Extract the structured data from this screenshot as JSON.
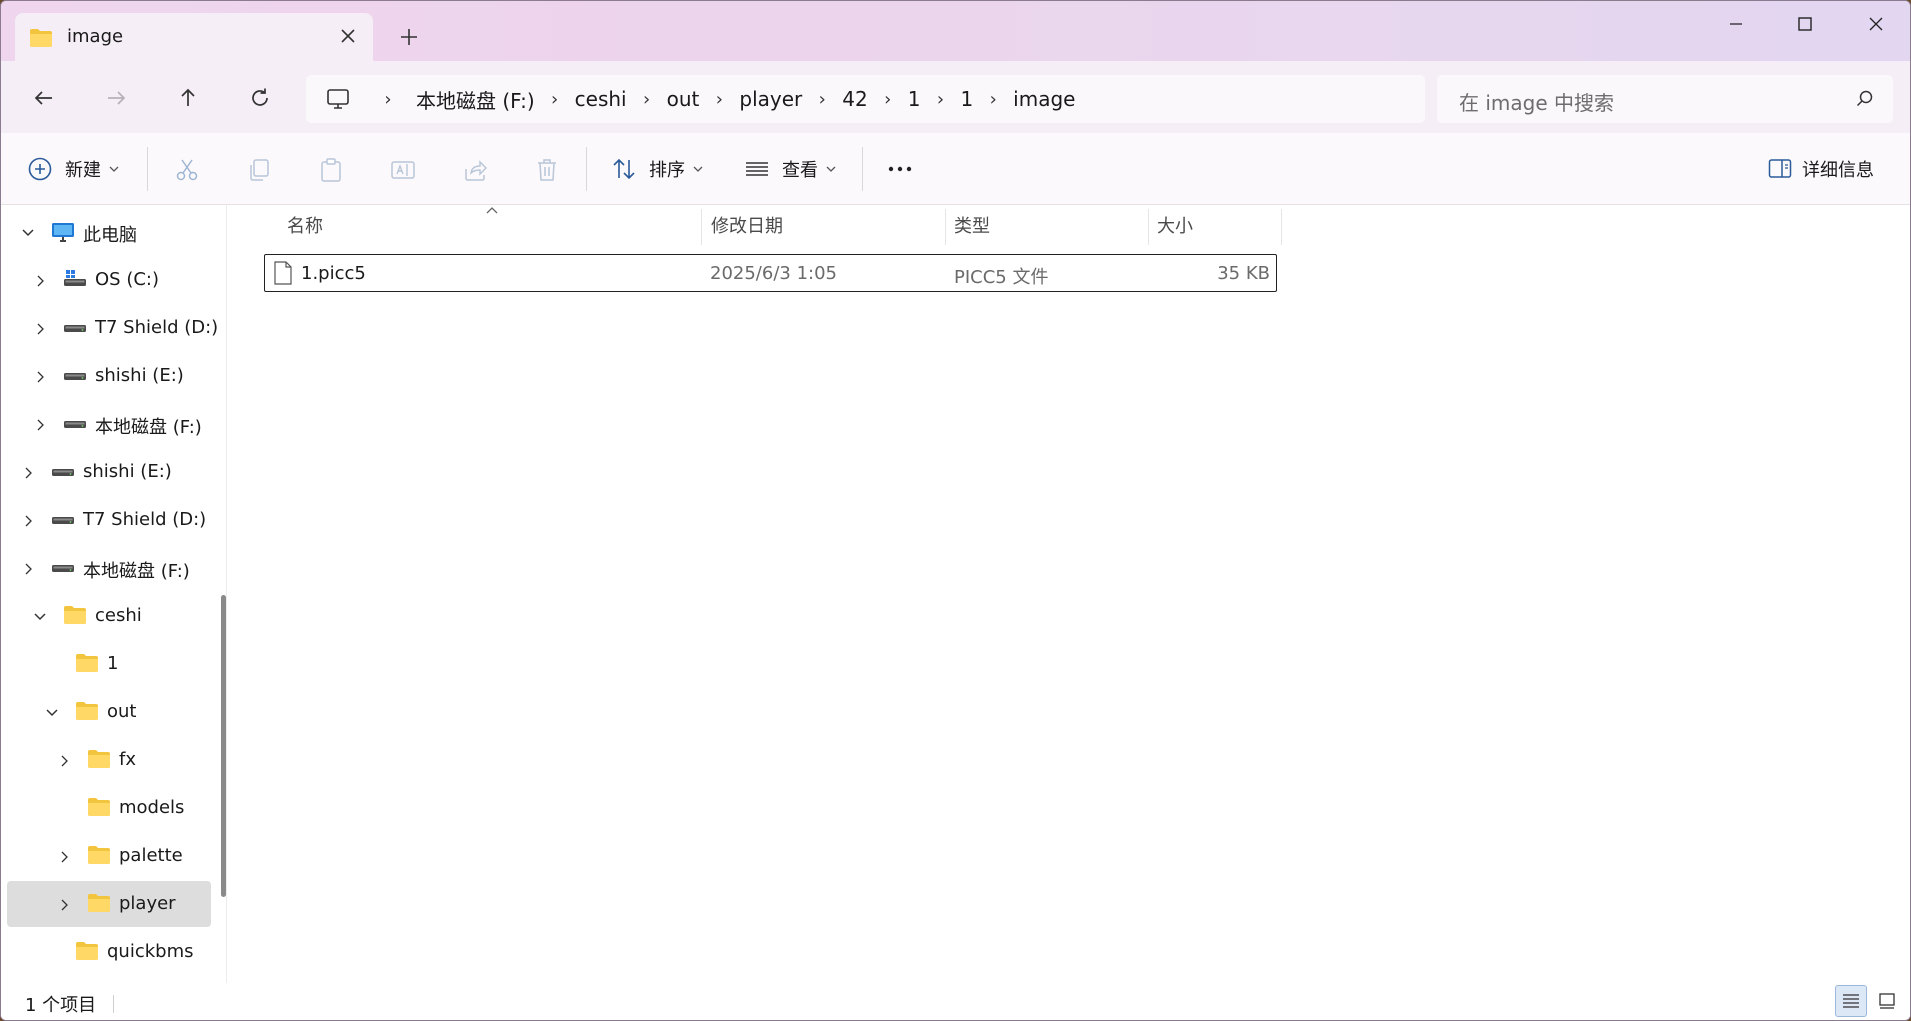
{
  "tab": {
    "title": "image"
  },
  "address": {
    "crumbs": [
      "本地磁盘 (F:)",
      "ceshi",
      "out",
      "player",
      "42",
      "1",
      "1",
      "image"
    ]
  },
  "search": {
    "placeholder": "在 image 中搜索"
  },
  "toolbar": {
    "new_label": "新建",
    "sort_label": "排序",
    "view_label": "查看",
    "details_label": "详细信息"
  },
  "tree": [
    {
      "label": "此电脑",
      "depth": 0,
      "chevron": "down",
      "icon": "pc-icon"
    },
    {
      "label": "OS (C:)",
      "depth": 1,
      "chevron": "right",
      "icon": "windows-drive-icon"
    },
    {
      "label": "T7 Shield (D:)",
      "depth": 1,
      "chevron": "right",
      "icon": "drive-icon"
    },
    {
      "label": "shishi (E:)",
      "depth": 1,
      "chevron": "right",
      "icon": "drive-icon"
    },
    {
      "label": "本地磁盘 (F:)",
      "depth": 1,
      "chevron": "right",
      "icon": "drive-icon"
    },
    {
      "label": "shishi (E:)",
      "depth": 0,
      "chevron": "right",
      "icon": "drive-icon"
    },
    {
      "label": "T7 Shield (D:)",
      "depth": 0,
      "chevron": "right",
      "icon": "drive-icon"
    },
    {
      "label": "本地磁盘 (F:)",
      "depth": 0,
      "chevron": "right",
      "icon": "drive-icon"
    },
    {
      "label": "ceshi",
      "depth": 1,
      "chevron": "down",
      "icon": "folder-icon"
    },
    {
      "label": "1",
      "depth": 2,
      "chevron": "none",
      "icon": "folder-icon"
    },
    {
      "label": "out",
      "depth": 2,
      "chevron": "down",
      "icon": "folder-icon"
    },
    {
      "label": "fx",
      "depth": 3,
      "chevron": "right",
      "icon": "folder-icon"
    },
    {
      "label": "models",
      "depth": 3,
      "chevron": "none",
      "icon": "folder-icon"
    },
    {
      "label": "palette",
      "depth": 3,
      "chevron": "right",
      "icon": "folder-icon"
    },
    {
      "label": "player",
      "depth": 3,
      "chevron": "right",
      "icon": "folder-icon",
      "selected": true
    },
    {
      "label": "quickbms",
      "depth": 2,
      "chevron": "none",
      "icon": "folder-icon"
    }
  ],
  "columns": {
    "name": "名称",
    "modified": "修改日期",
    "type": "类型",
    "size": "大小"
  },
  "files": [
    {
      "name": "1.picc5",
      "modified": "2025/6/3 1:05",
      "type": "PICC5 文件",
      "size": "35 KB"
    }
  ],
  "status": {
    "count": "1 个项目"
  }
}
